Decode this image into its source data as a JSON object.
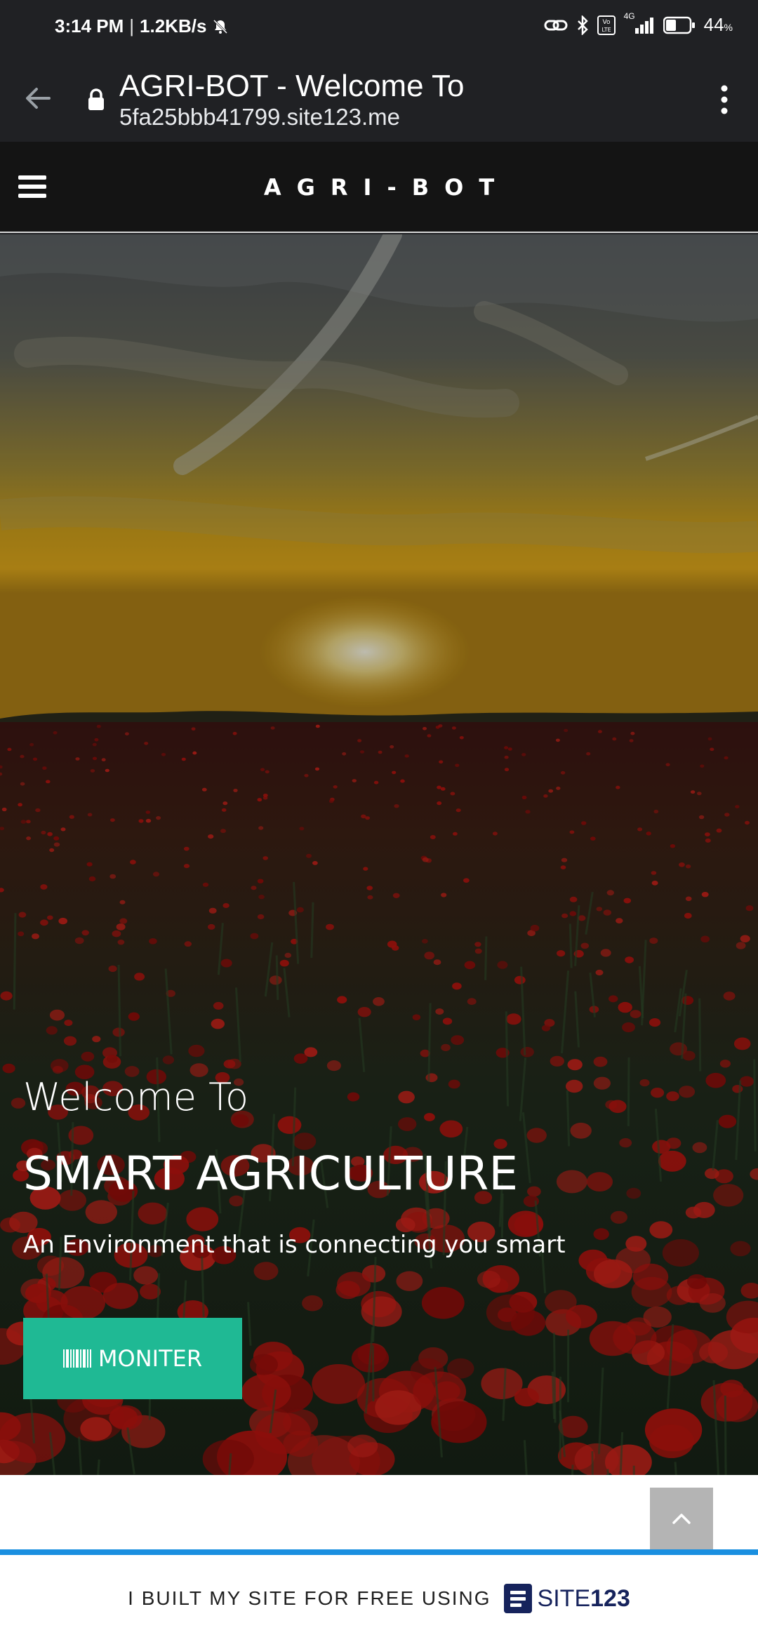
{
  "status_bar": {
    "time": "3:14 PM",
    "speed": "1.2KB/s",
    "network": "4G",
    "battery": "44",
    "battery_unit": "%",
    "battery_level": 0.44
  },
  "browser": {
    "title": "AGRI-BOT - Welcome To",
    "url": "5fa25bbb41799.site123.me"
  },
  "site": {
    "brand": "AGRI-BOT"
  },
  "hero": {
    "welcome": "Welcome To",
    "title": "SMART AGRICULTURE",
    "subtitle": "An Environment that is connecting you smart",
    "button_label": "MONITER"
  },
  "promo": {
    "text": "I BUILT MY SITE FOR FREE USING",
    "logo_text": "SITE",
    "logo_num": "123"
  },
  "colors": {
    "accent": "#1fb994",
    "promo_border": "#1a8fe0",
    "logo": "#16235c"
  }
}
